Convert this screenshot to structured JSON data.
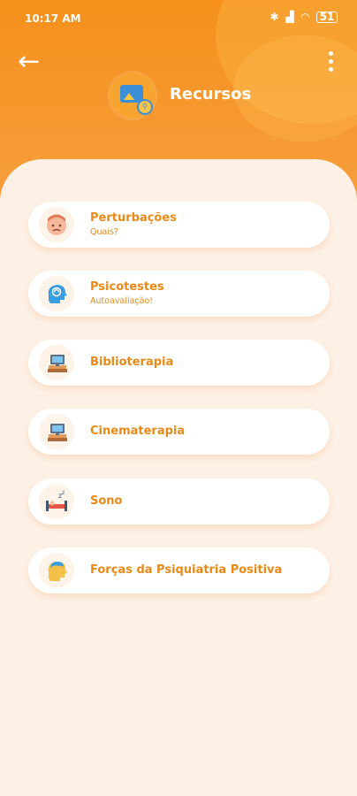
{
  "status_bar": {
    "time": "10:17 AM",
    "battery": "51"
  },
  "header": {
    "title": "Recursos"
  },
  "menu": [
    {
      "label": "Perturbações",
      "sublabel": "Quais?",
      "icon": "person-face-icon"
    },
    {
      "label": "Psicotestes",
      "sublabel": "Autoavaliação!",
      "icon": "brain-head-icon"
    },
    {
      "label": "Biblioterapia",
      "sublabel": "",
      "icon": "books-computer-icon"
    },
    {
      "label": "Cinematerapia",
      "sublabel": "",
      "icon": "movie-books-icon"
    },
    {
      "label": "Sono",
      "sublabel": "",
      "icon": "bed-icon"
    },
    {
      "label": "Forças da Psiquiatria Positiva",
      "sublabel": "",
      "icon": "mind-strength-icon"
    }
  ],
  "colors": {
    "header": "#f5901b",
    "accent_text": "#e98a18",
    "background": "#fdf1e6"
  }
}
